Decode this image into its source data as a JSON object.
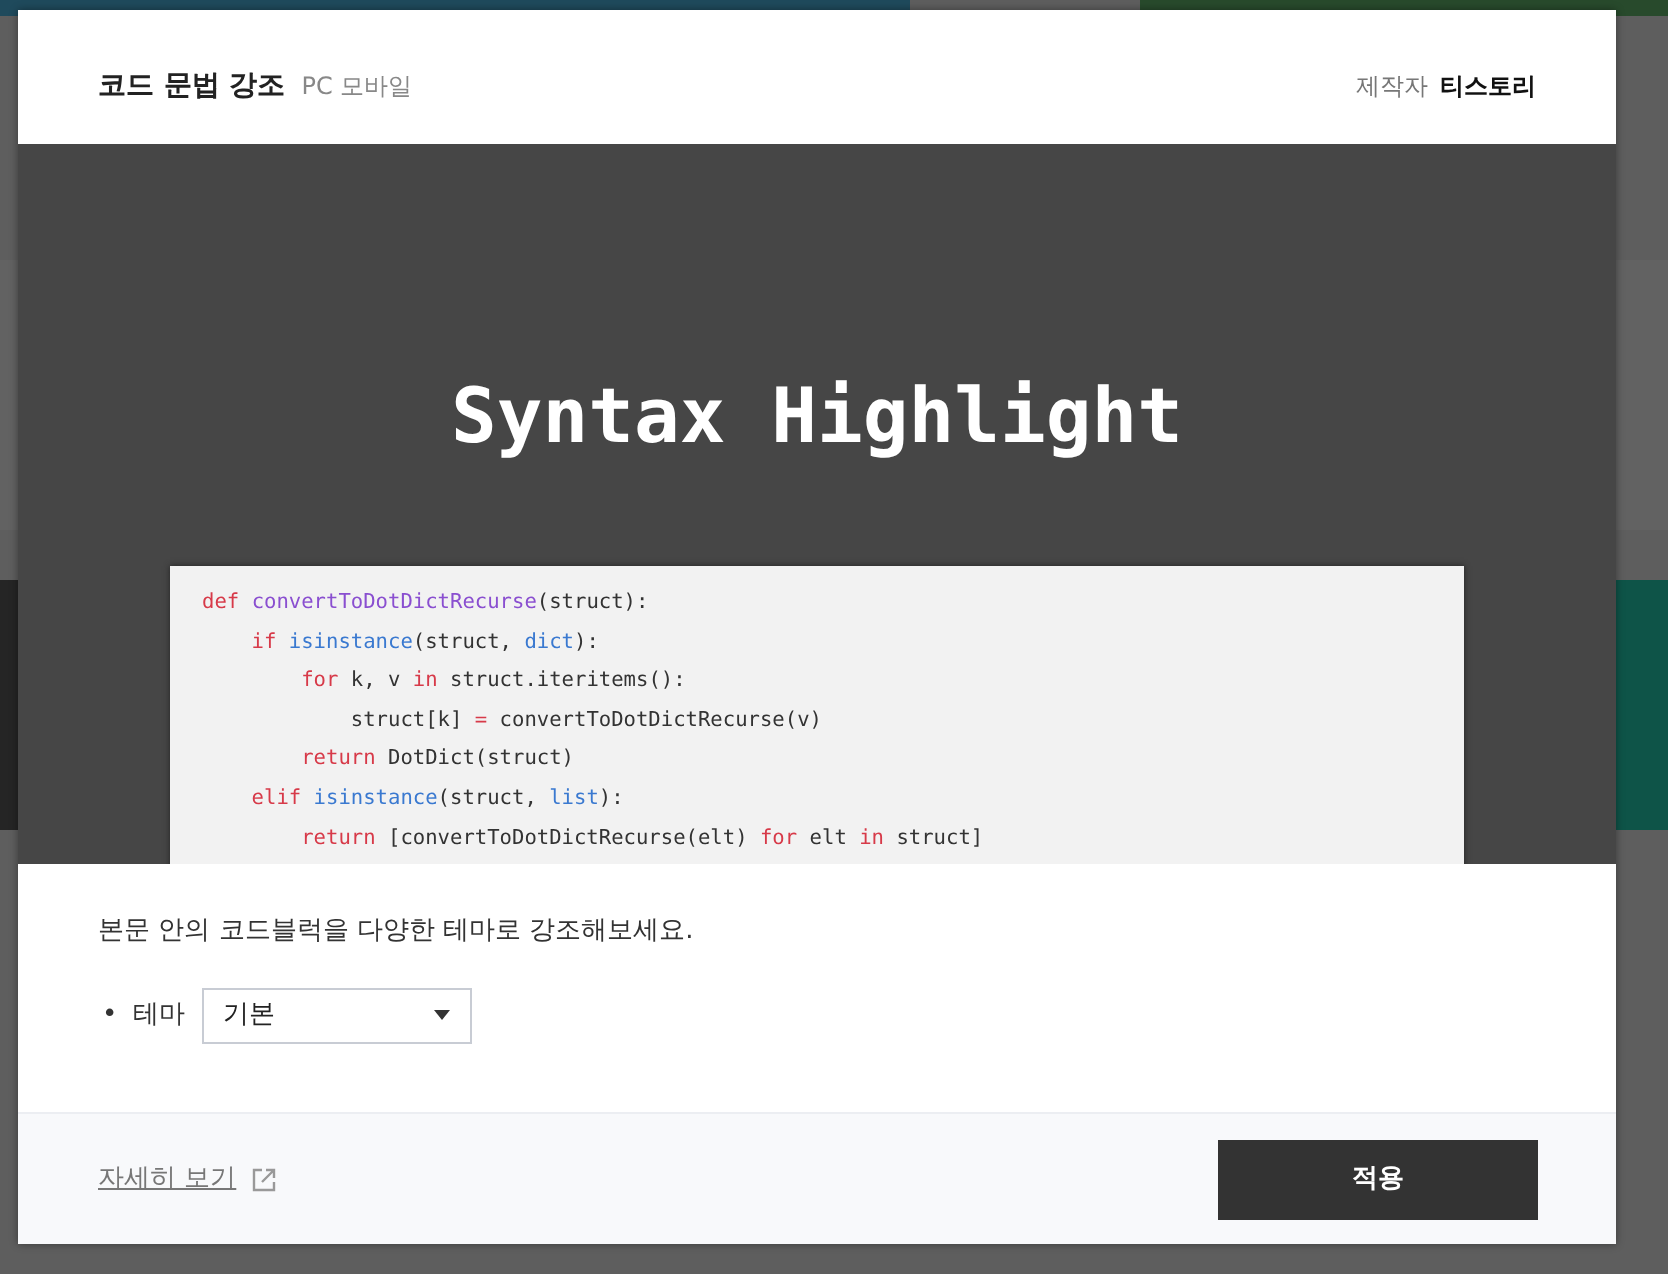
{
  "modal": {
    "title": "코드 문법 강조",
    "platforms": "PC 모바일",
    "maker_label": "제작자",
    "maker": "티스토리"
  },
  "preview": {
    "heading": "Syntax Highlight",
    "code_lines": [
      [
        {
          "text": "def ",
          "kind": "keyword"
        },
        {
          "text": "convertToDotDictRecurse",
          "kind": "function"
        },
        {
          "text": "(struct):",
          "kind": "plain"
        }
      ],
      [
        {
          "text": "    if ",
          "kind": "keyword"
        },
        {
          "text": "isinstance",
          "kind": "builtin"
        },
        {
          "text": "(struct, ",
          "kind": "plain"
        },
        {
          "text": "dict",
          "kind": "builtin"
        },
        {
          "text": "):",
          "kind": "plain"
        }
      ],
      [
        {
          "text": "        for",
          "kind": "keyword"
        },
        {
          "text": " k, v ",
          "kind": "plain"
        },
        {
          "text": "in",
          "kind": "keyword"
        },
        {
          "text": " struct.iteritems():",
          "kind": "plain"
        }
      ],
      [
        {
          "text": "            struct[k] ",
          "kind": "plain"
        },
        {
          "text": "=",
          "kind": "keyword"
        },
        {
          "text": " convertToDotDictRecurse(v)",
          "kind": "plain"
        }
      ],
      [
        {
          "text": "        return",
          "kind": "keyword"
        },
        {
          "text": " DotDict(struct)",
          "kind": "plain"
        }
      ],
      [
        {
          "text": "    elif ",
          "kind": "keyword"
        },
        {
          "text": "isinstance",
          "kind": "builtin"
        },
        {
          "text": "(struct, ",
          "kind": "plain"
        },
        {
          "text": "list",
          "kind": "builtin"
        },
        {
          "text": "):",
          "kind": "plain"
        }
      ],
      [
        {
          "text": "        return",
          "kind": "keyword"
        },
        {
          "text": " [convertToDotDictRecurse(elt) ",
          "kind": "plain"
        },
        {
          "text": "for",
          "kind": "keyword"
        },
        {
          "text": " elt ",
          "kind": "plain"
        },
        {
          "text": "in",
          "kind": "keyword"
        },
        {
          "text": " struct]",
          "kind": "plain"
        }
      ]
    ]
  },
  "description": "본문 안의 코드블럭을 다양한 테마로 강조해보세요.",
  "options": [
    {
      "bullet": "•",
      "label": "테마",
      "value": "기본"
    }
  ],
  "footer": {
    "link": "자세히 보기",
    "apply_button": "적용"
  }
}
